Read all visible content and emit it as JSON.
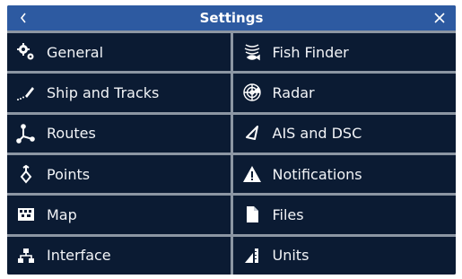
{
  "header": {
    "title": "Settings",
    "back_icon": "chevron-left-icon",
    "close_icon": "close-icon"
  },
  "colors": {
    "titlebar": "#2d5aa1",
    "panel": "#0b1b33",
    "divider": "#8c96a3",
    "text": "#ffffff"
  },
  "menu": {
    "items": [
      {
        "label": "General",
        "icon": "gears-icon"
      },
      {
        "label": "Fish Finder",
        "icon": "fish-finder-icon"
      },
      {
        "label": "Ship and Tracks",
        "icon": "ship-track-icon"
      },
      {
        "label": "Radar",
        "icon": "radar-icon"
      },
      {
        "label": "Routes",
        "icon": "routes-icon"
      },
      {
        "label": "AIS and DSC",
        "icon": "ais-icon"
      },
      {
        "label": "Points",
        "icon": "points-icon"
      },
      {
        "label": "Notifications",
        "icon": "warning-icon"
      },
      {
        "label": "Map",
        "icon": "map-icon"
      },
      {
        "label": "Files",
        "icon": "file-icon"
      },
      {
        "label": "Interface",
        "icon": "interface-icon"
      },
      {
        "label": "Units",
        "icon": "units-icon"
      }
    ]
  }
}
